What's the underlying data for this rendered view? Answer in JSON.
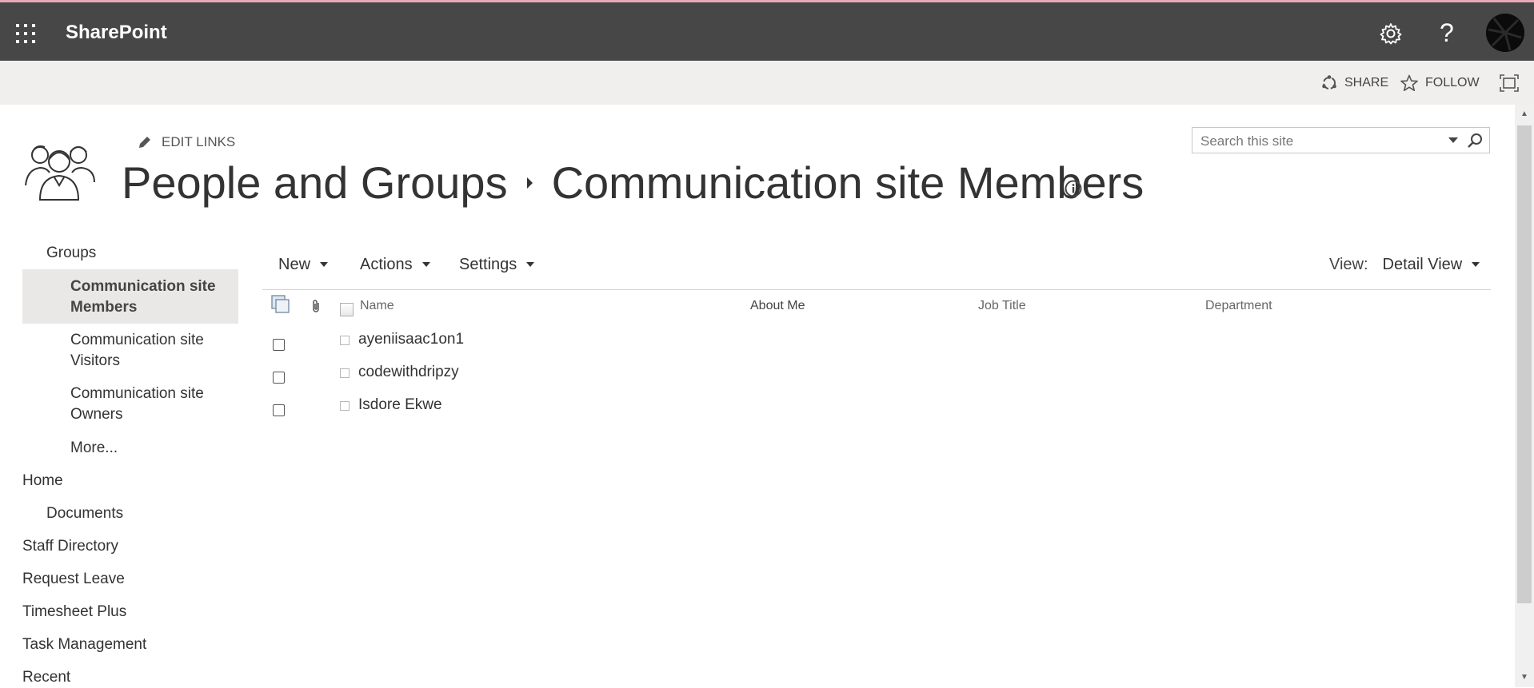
{
  "suite_bar": {
    "app_name": "SharePoint",
    "help_glyph": "?",
    "icons": [
      "waffle-icon",
      "gear-icon",
      "avatar"
    ]
  },
  "ribbon": {
    "share_label": "SHARE",
    "follow_label": "FOLLOW",
    "icons": [
      "share-icon",
      "star-icon",
      "focus-icon"
    ]
  },
  "header": {
    "edit_links_label": "EDIT LINKS",
    "breadcrumb_root": "People and Groups",
    "breadcrumb_current": "Communication site Members",
    "search_placeholder": "Search this site"
  },
  "left_nav": {
    "groups_label": "Groups",
    "group_items": [
      {
        "line1": "Communication site",
        "line2": "Members",
        "selected": true
      },
      {
        "line1": "Communication site",
        "line2": "Visitors",
        "selected": false
      },
      {
        "line1": "Communication site",
        "line2": "Owners",
        "selected": false
      }
    ],
    "more_label": "More...",
    "links": [
      "Home",
      "Documents",
      "Staff Directory",
      "Request Leave",
      "Timesheet Plus",
      "Task Management",
      "Recent"
    ]
  },
  "toolbar": {
    "new_label": "New",
    "actions_label": "Actions",
    "settings_label": "Settings",
    "view_prefix": "View:",
    "view_value": "Detail View"
  },
  "table": {
    "columns": [
      "Name",
      "About Me",
      "Job Title",
      "Department"
    ],
    "rows": [
      {
        "name": "ayeniisaac1on1",
        "about_me": "",
        "job_title": "",
        "department": ""
      },
      {
        "name": "codewithdripzy",
        "about_me": "",
        "job_title": "",
        "department": ""
      },
      {
        "name": "Isdore Ekwe",
        "about_me": "",
        "job_title": "",
        "department": ""
      }
    ]
  },
  "colors": {
    "suite_bar_bg": "#474747",
    "ribbon_bg": "#f1efee",
    "selected_nav_bg": "#eae8e7"
  }
}
